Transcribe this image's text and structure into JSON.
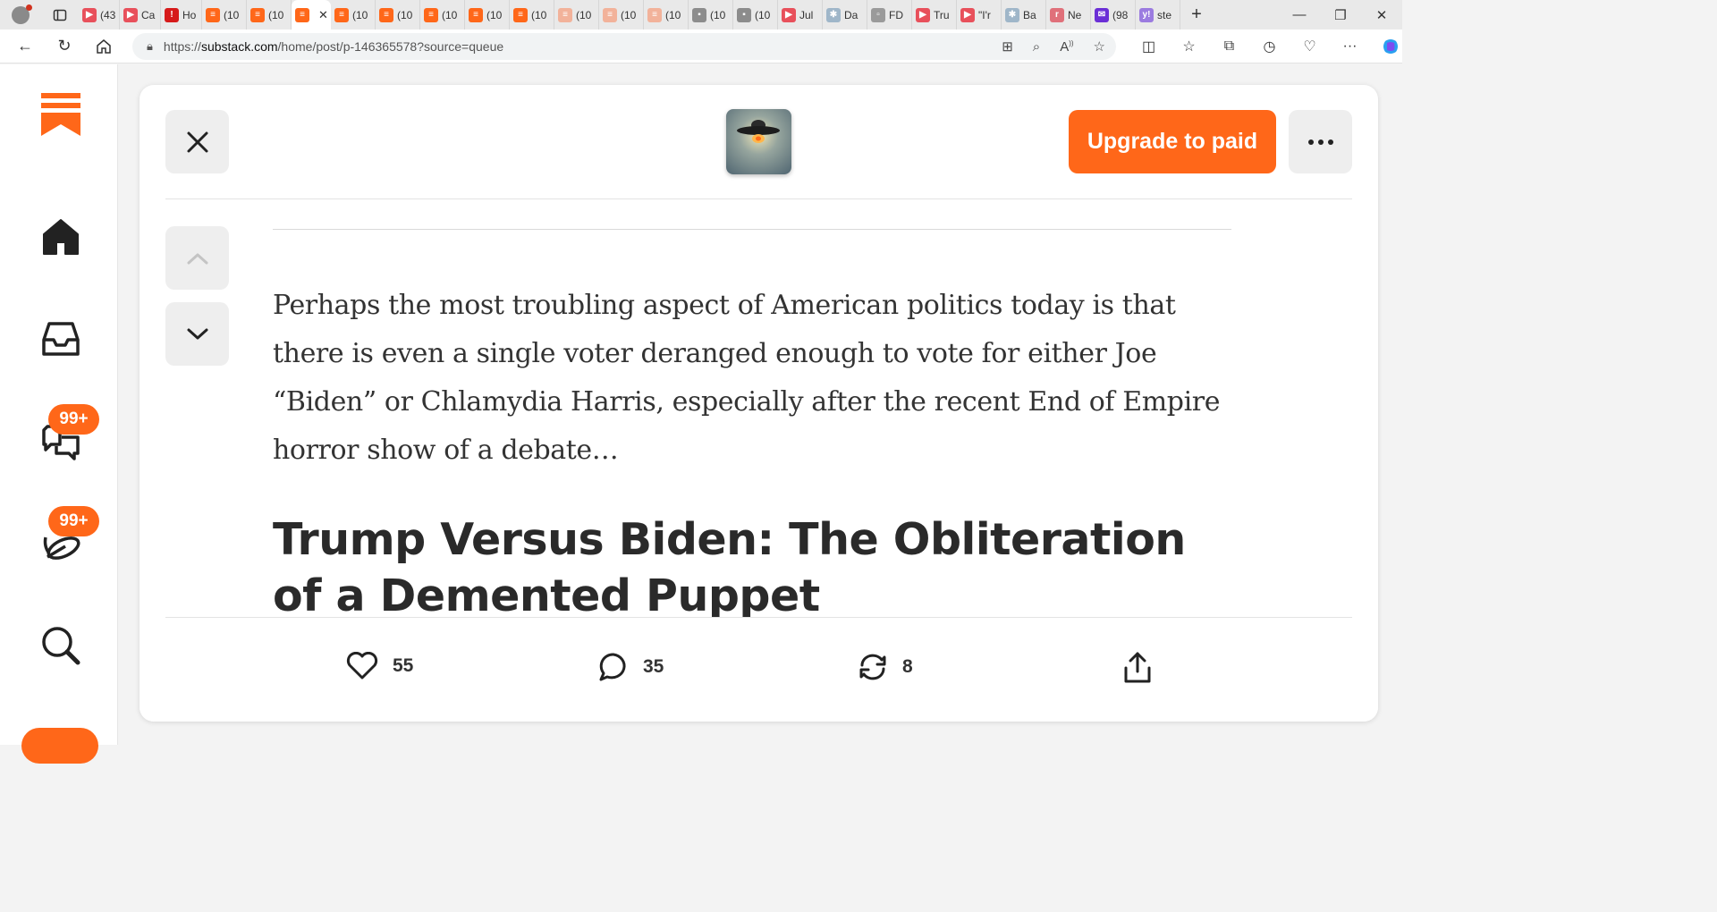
{
  "browser": {
    "tabs": [
      {
        "label": "(43",
        "color": "#e8505b",
        "glyph": "▶"
      },
      {
        "label": "Ca",
        "color": "#e8505b",
        "glyph": "▶"
      },
      {
        "label": "Ho",
        "color": "#d61a1a",
        "glyph": "!"
      },
      {
        "label": "(10",
        "color": "#ff6719",
        "glyph": "≡"
      },
      {
        "label": "(10",
        "color": "#ff6719",
        "glyph": "≡"
      },
      {
        "label": "",
        "color": "#ff6719",
        "glyph": "≡",
        "active": true
      },
      {
        "label": "(10",
        "color": "#ff6719",
        "glyph": "≡"
      },
      {
        "label": "(10",
        "color": "#ff6719",
        "glyph": "≡"
      },
      {
        "label": "(10",
        "color": "#ff6719",
        "glyph": "≡"
      },
      {
        "label": "(10",
        "color": "#ff6719",
        "glyph": "≡"
      },
      {
        "label": "(10",
        "color": "#ff6719",
        "glyph": "≡"
      },
      {
        "label": "(10",
        "color": "#f2b29a",
        "glyph": "≡"
      },
      {
        "label": "(10",
        "color": "#f2b29a",
        "glyph": "≡"
      },
      {
        "label": "(10",
        "color": "#f2b29a",
        "glyph": "≡"
      },
      {
        "label": "(10",
        "color": "#8c8c8c",
        "glyph": "▪"
      },
      {
        "label": "(10",
        "color": "#8c8c8c",
        "glyph": "▪"
      },
      {
        "label": "Jul",
        "color": "#e8505b",
        "glyph": "▶"
      },
      {
        "label": "Da",
        "color": "#9fb6c9",
        "glyph": "✱"
      },
      {
        "label": "FD",
        "color": "#9a9a9a",
        "glyph": "▫"
      },
      {
        "label": "Tru",
        "color": "#e8505b",
        "glyph": "▶"
      },
      {
        "label": "\"I'r",
        "color": "#e8505b",
        "glyph": "▶"
      },
      {
        "label": "Ba",
        "color": "#9fb6c9",
        "glyph": "✱"
      },
      {
        "label": "Ne",
        "color": "#e0707a",
        "glyph": "r"
      },
      {
        "label": "(98",
        "color": "#6b2fd6",
        "glyph": "✉"
      },
      {
        "label": "ste",
        "color": "#9b7be0",
        "glyph": "y!"
      }
    ],
    "address": {
      "scheme": "https://",
      "host": "substack.com",
      "path": "/home/post/p-146365578?source=queue"
    }
  },
  "rail": {
    "chat_badge": "99+",
    "activity_badge": "99+"
  },
  "post": {
    "upgrade_label": "Upgrade to paid",
    "excerpt": "Perhaps the most troubling aspect of American politics today is that there is even a single voter deranged enough to vote for either Joe “Biden” or Chlamydia Harris, especially after the recent End of Empire horror show of a debate…",
    "title": "Trump Versus Biden: The Obliteration of a Demented Puppet",
    "likes": "55",
    "comments": "35",
    "restacks": "8"
  },
  "colors": {
    "accent": "#ff6719",
    "button_gray": "#eeeeee"
  }
}
